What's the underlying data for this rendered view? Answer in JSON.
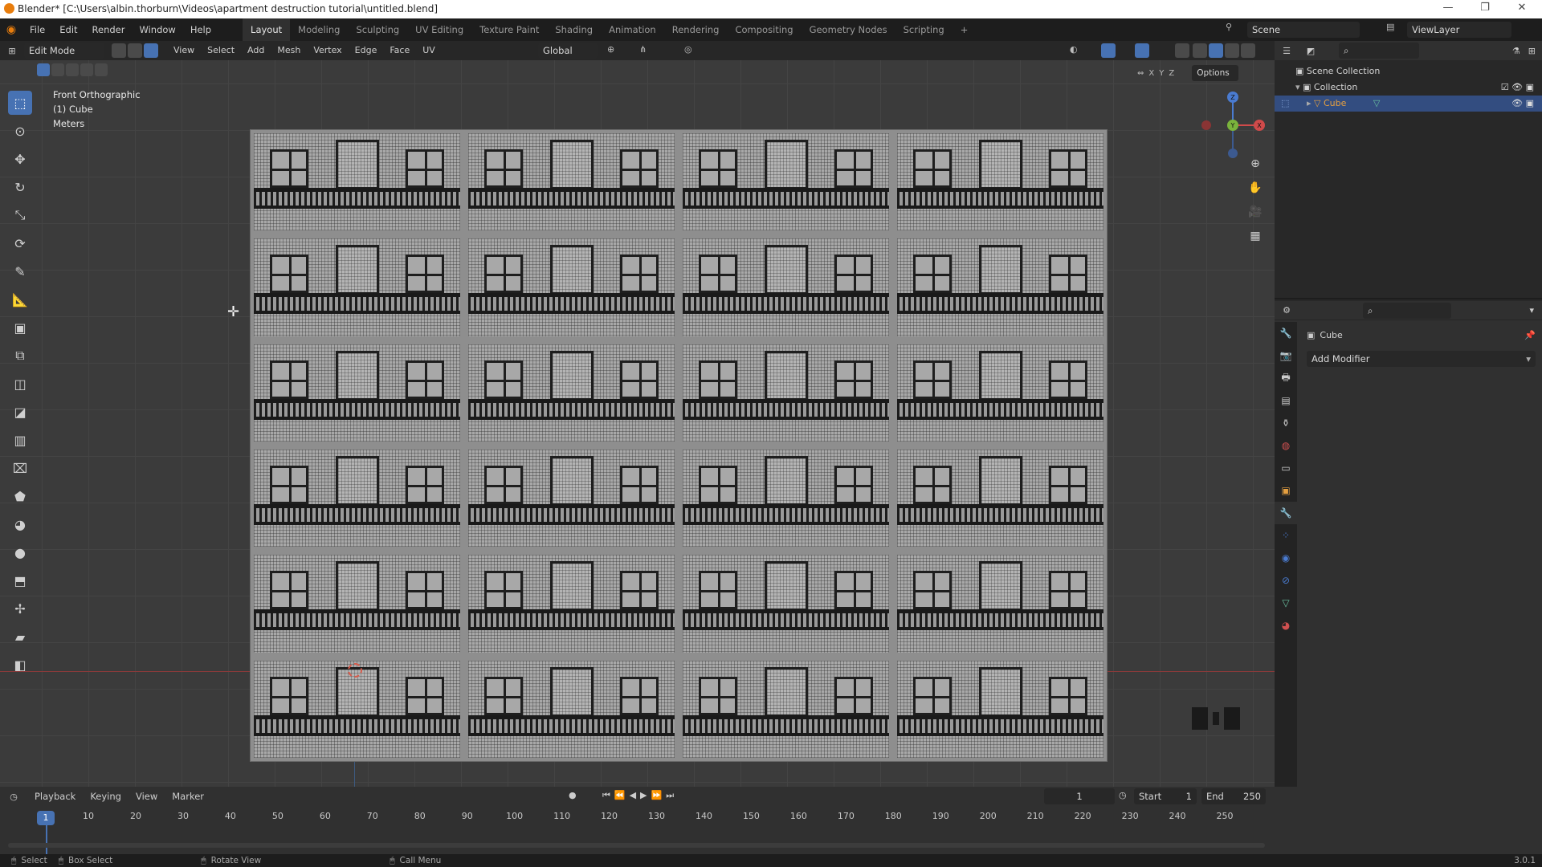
{
  "window": {
    "title": "Blender* [C:\\Users\\albin.thorburn\\Videos\\apartment destruction tutorial\\untitled.blend]",
    "minimize": "—",
    "maximize": "❐",
    "close": "✕"
  },
  "topbar": {
    "menus": [
      "File",
      "Edit",
      "Render",
      "Window",
      "Help"
    ],
    "workspaces": [
      "Layout",
      "Modeling",
      "Sculpting",
      "UV Editing",
      "Texture Paint",
      "Shading",
      "Animation",
      "Rendering",
      "Compositing",
      "Geometry Nodes",
      "Scripting",
      "+"
    ],
    "active_workspace": "Layout",
    "scene": "Scene",
    "view_layer": "ViewLayer"
  },
  "viewport": {
    "mode": "Edit Mode",
    "menus": [
      "View",
      "Select",
      "Add",
      "Mesh",
      "Vertex",
      "Edge",
      "Face",
      "UV"
    ],
    "orientation": "Global",
    "options": "Options",
    "axes": [
      "X",
      "Y",
      "Z"
    ],
    "info": {
      "view": "Front Orthographic",
      "object": "(1) Cube",
      "units": "Meters"
    },
    "gizmo": {
      "x": "X",
      "y": "Y",
      "z": "Z"
    },
    "grid_units": 24
  },
  "outliner": {
    "root": "Scene Collection",
    "collection": "Collection",
    "object": "Cube"
  },
  "properties": {
    "object_name": "Cube",
    "add_modifier": "Add Modifier"
  },
  "timeline": {
    "menus": [
      "Playback",
      "Keying",
      "View",
      "Marker"
    ],
    "current_frame": "1",
    "start_label": "Start",
    "start": "1",
    "end_label": "End",
    "end": "250",
    "ticks": [
      "1",
      "10",
      "20",
      "30",
      "40",
      "50",
      "60",
      "70",
      "80",
      "90",
      "100",
      "110",
      "120",
      "130",
      "140",
      "150",
      "160",
      "170",
      "180",
      "190",
      "200",
      "210",
      "220",
      "230",
      "240",
      "250"
    ]
  },
  "statusbar": {
    "select": "Select",
    "box_select": "Box Select",
    "rotate_view": "Rotate View",
    "call_menu": "Call Menu",
    "version": "3.0.1"
  }
}
